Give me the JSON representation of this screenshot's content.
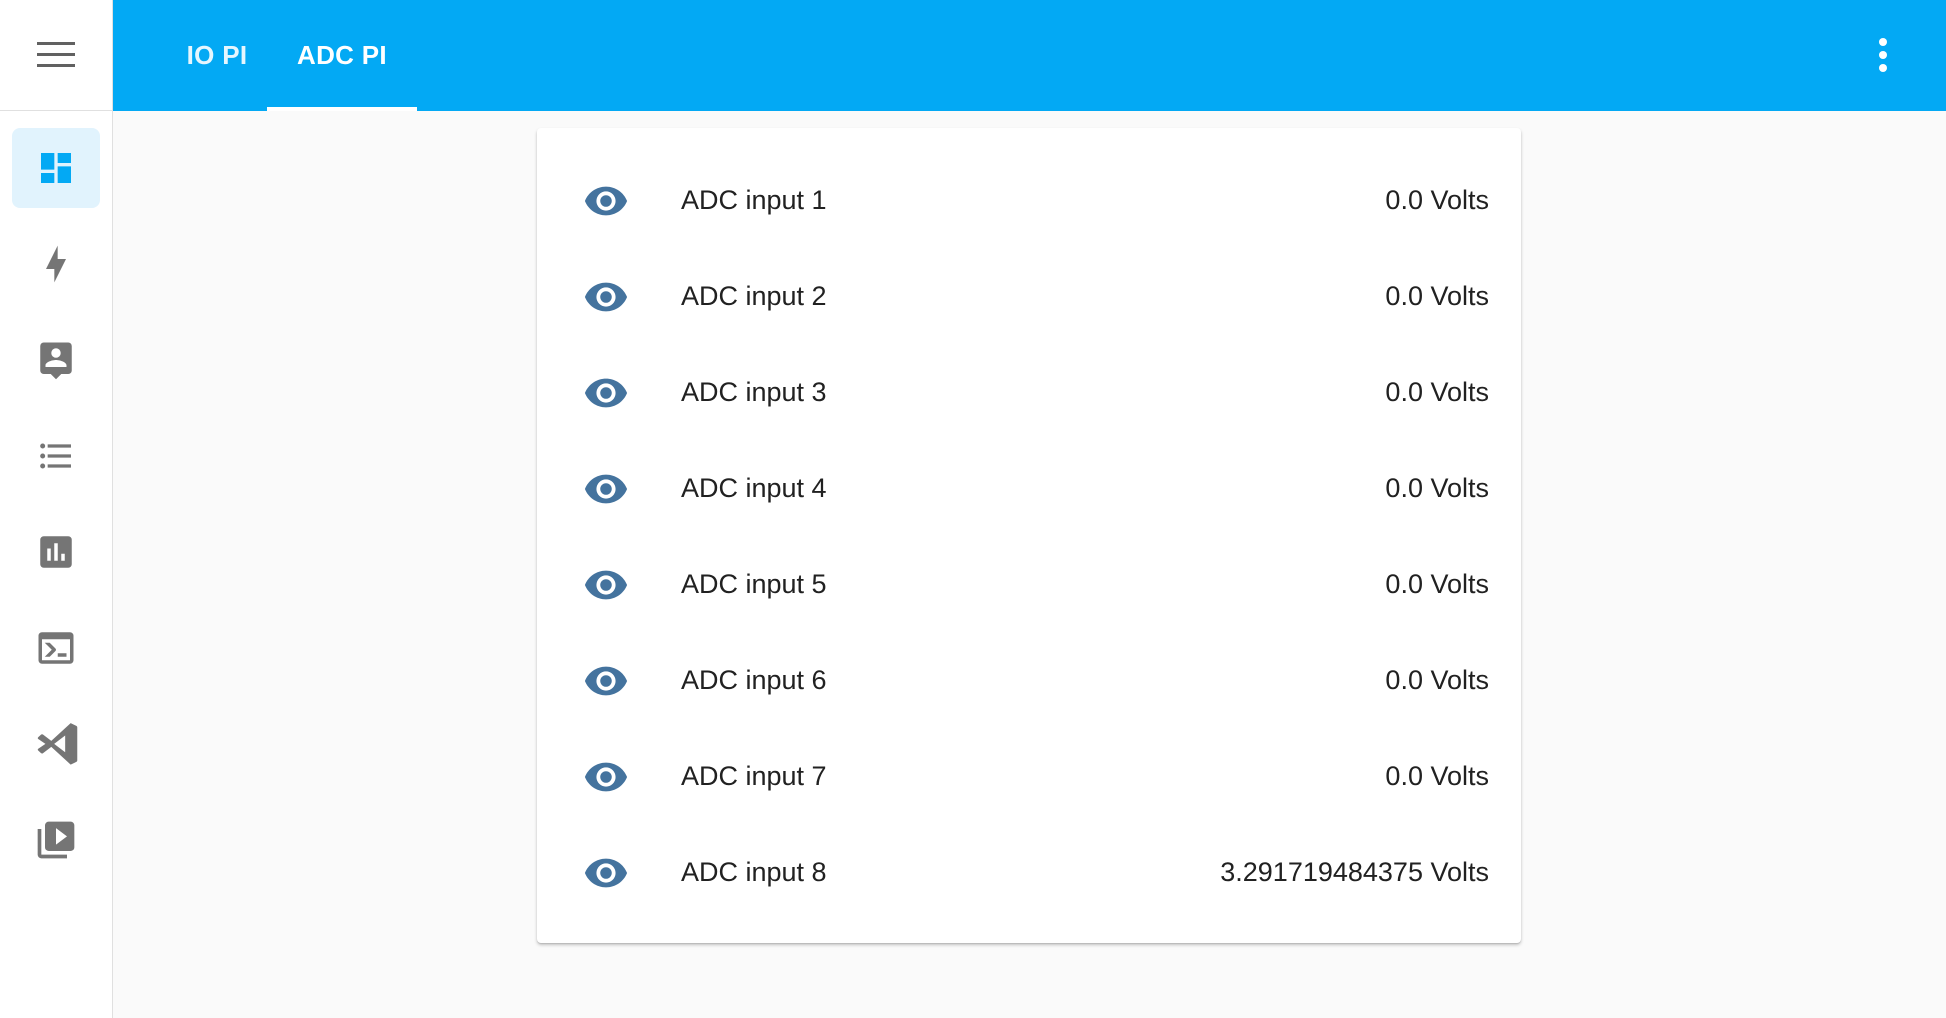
{
  "header": {
    "tabs": [
      {
        "label": "IO PI",
        "active": false
      },
      {
        "label": "ADC PI",
        "active": true
      }
    ],
    "menu_icon": "more-vertical-icon"
  },
  "sidebar": {
    "menu_icon": "hamburger-menu-icon",
    "items": [
      {
        "icon": "dashboard-icon",
        "active": true
      },
      {
        "icon": "lightning-bolt-icon",
        "active": false
      },
      {
        "icon": "account-box-icon",
        "active": false
      },
      {
        "icon": "list-icon",
        "active": false
      },
      {
        "icon": "bar-chart-icon",
        "active": false
      },
      {
        "icon": "terminal-icon",
        "active": false
      },
      {
        "icon": "code-editor-icon",
        "active": false
      },
      {
        "icon": "media-library-icon",
        "active": false
      }
    ]
  },
  "card": {
    "rows": [
      {
        "name": "ADC input 1",
        "value": "0.0 Volts"
      },
      {
        "name": "ADC input 2",
        "value": "0.0 Volts"
      },
      {
        "name": "ADC input 3",
        "value": "0.0 Volts"
      },
      {
        "name": "ADC input 4",
        "value": "0.0 Volts"
      },
      {
        "name": "ADC input 5",
        "value": "0.0 Volts"
      },
      {
        "name": "ADC input 6",
        "value": "0.0 Volts"
      },
      {
        "name": "ADC input 7",
        "value": "0.0 Volts"
      },
      {
        "name": "ADC input 8",
        "value": "3.291719484375 Volts"
      }
    ]
  },
  "colors": {
    "primary": "#03a9f4",
    "sidebar_icon": "#757575",
    "sidebar_active_icon": "#03a9f4",
    "sidebar_active_bg": "#e1f3fd",
    "row_icon": "#44739e",
    "text": "#212121"
  }
}
